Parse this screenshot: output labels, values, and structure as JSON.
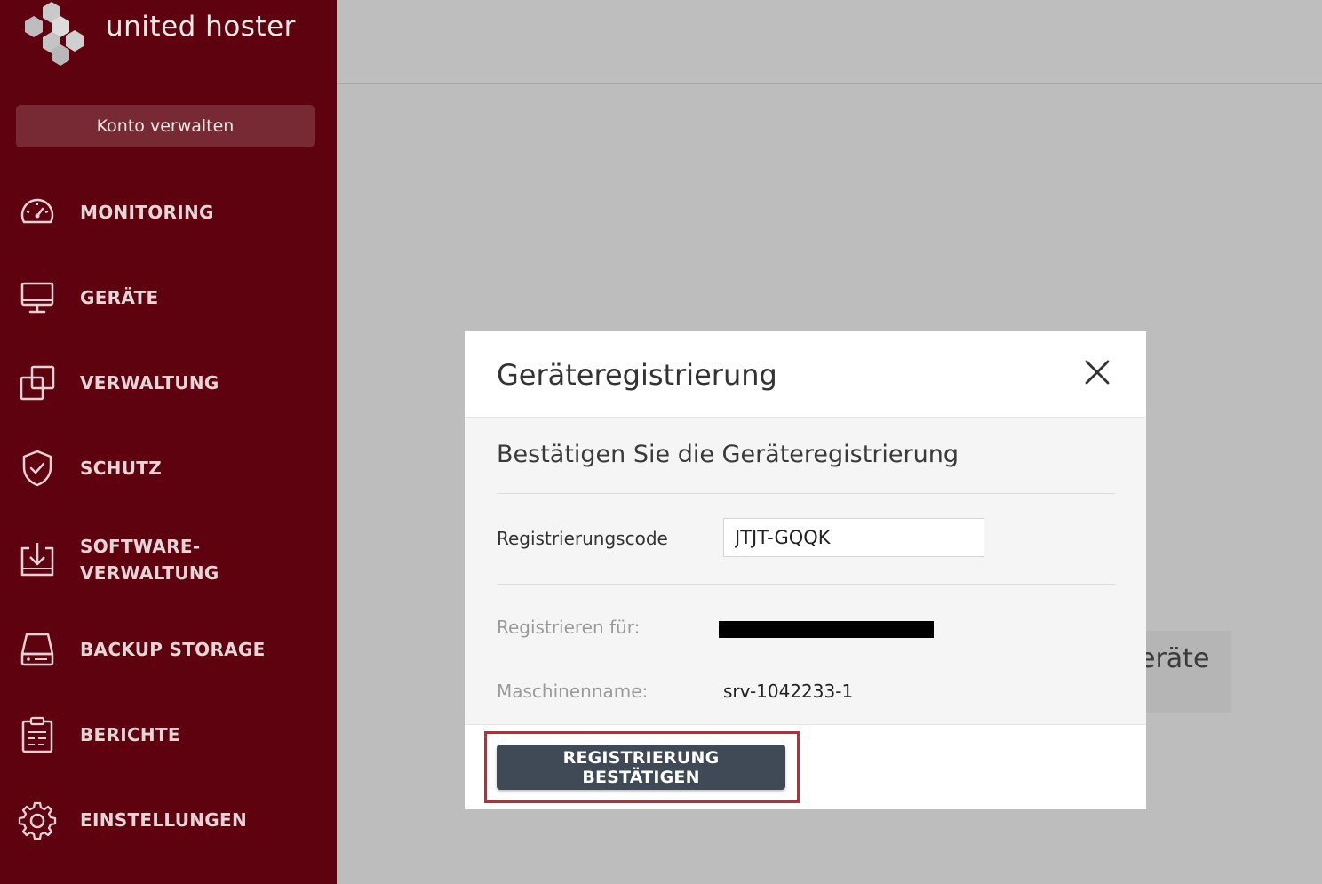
{
  "brand": {
    "name": "united hoster",
    "logo_icon": "hexagon-cluster-icon"
  },
  "sidebar": {
    "account_button": "Konto verwalten",
    "items": [
      {
        "label": "MONITORING",
        "icon": "speedometer-icon"
      },
      {
        "label": "GERÄTE",
        "icon": "monitor-icon"
      },
      {
        "label": "VERWALTUNG",
        "icon": "copy-windows-icon"
      },
      {
        "label": "SCHUTZ",
        "icon": "shield-check-icon"
      },
      {
        "label": "SOFTWARE-VERWALTUNG",
        "label_line1": "SOFTWARE-",
        "label_line2": "VERWALTUNG",
        "icon": "download-tray-icon"
      },
      {
        "label": "BACKUP STORAGE",
        "icon": "hard-drive-icon"
      },
      {
        "label": "BERICHTE",
        "icon": "clipboard-report-icon"
      },
      {
        "label": "EINSTELLUNGEN",
        "icon": "gear-icon"
      }
    ]
  },
  "background": {
    "partial_heading": "eräte"
  },
  "modal": {
    "title": "Geräteregistrierung",
    "close_icon": "close-icon",
    "section_title": "Bestätigen Sie die Geräteregistrierung",
    "code_label": "Registrierungscode",
    "code_value": "JTJT-GQQK",
    "register_for_label": "Registrieren für:",
    "machine_label": "Maschinenname:",
    "machine_value": "srv-1042233-1",
    "confirm_button": "REGISTRIERUNG BESTÄTIGEN"
  },
  "colors": {
    "sidebar_bg": "#5f0210",
    "account_button_bg": "#772a33",
    "backdrop": "#bdbdbd",
    "confirm_button_bg": "#3f4a56",
    "highlight_border": "#d9202a"
  }
}
